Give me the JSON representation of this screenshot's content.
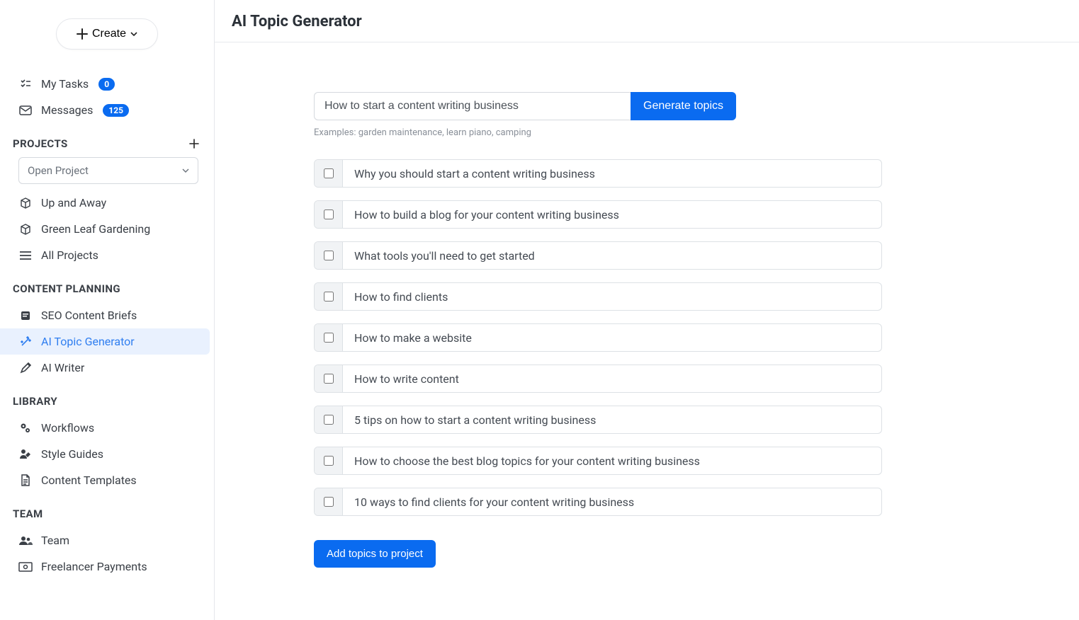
{
  "header": {
    "title": "AI Topic Generator"
  },
  "create_label": "Create",
  "sidebar": {
    "top": [
      {
        "label": "My Tasks",
        "badge": "0"
      },
      {
        "label": "Messages",
        "badge": "125"
      }
    ],
    "projects_header": "PROJECTS",
    "open_project_placeholder": "Open Project",
    "projects": [
      {
        "label": "Up and Away"
      },
      {
        "label": "Green Leaf Gardening"
      },
      {
        "label": "All Projects"
      }
    ],
    "planning_header": "CONTENT PLANNING",
    "planning": [
      {
        "label": "SEO Content Briefs"
      },
      {
        "label": "AI Topic Generator"
      },
      {
        "label": "AI Writer"
      }
    ],
    "library_header": "LIBRARY",
    "library": [
      {
        "label": "Workflows"
      },
      {
        "label": "Style Guides"
      },
      {
        "label": "Content Templates"
      }
    ],
    "team_header": "TEAM",
    "team": [
      {
        "label": "Team"
      },
      {
        "label": "Freelancer Payments"
      }
    ]
  },
  "generator": {
    "input_value": "How to start a content writing business",
    "generate_label": "Generate topics",
    "examples_label": "Examples: garden maintenance, learn piano, camping",
    "topics": [
      "Why you should start a content writing business",
      "How to build a blog for your content writing business",
      "What tools you'll need to get started",
      "How to find clients",
      "How to make a website",
      "How to write content",
      "5 tips on how to start a content writing business",
      "How to choose the best blog topics for your content writing business",
      "10 ways to find clients for your content writing business"
    ],
    "add_label": "Add topics to project"
  }
}
